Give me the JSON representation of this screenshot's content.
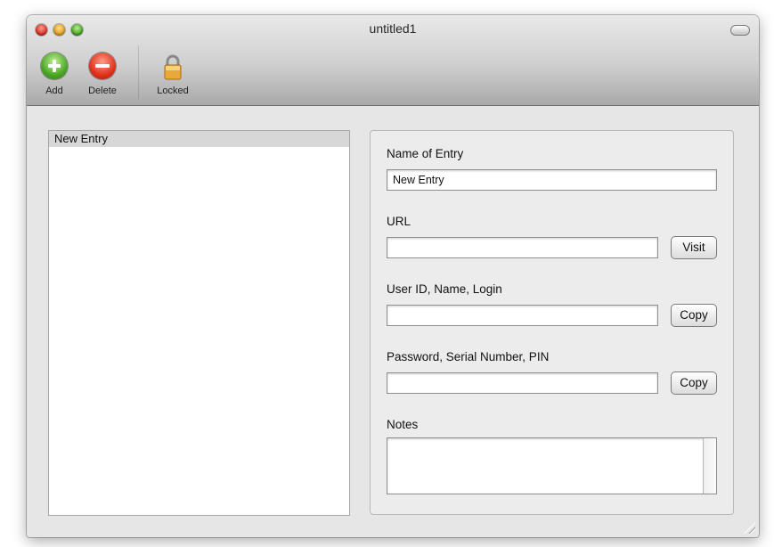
{
  "window": {
    "title": "untitled1"
  },
  "toolbar": {
    "add_label": "Add",
    "delete_label": "Delete",
    "locked_label": "Locked"
  },
  "entries": [
    {
      "name": "New Entry",
      "selected": true
    }
  ],
  "detail": {
    "name_label": "Name of Entry",
    "name_value": "New Entry",
    "url_label": "URL",
    "url_value": "",
    "visit_label": "Visit",
    "user_label": "User ID, Name, Login",
    "user_value": "",
    "copy_user_label": "Copy",
    "password_label": "Password, Serial Number, PIN",
    "password_value": "",
    "copy_password_label": "Copy",
    "notes_label": "Notes",
    "notes_value": ""
  },
  "icons": {
    "add": "plus-circle-icon",
    "delete": "minus-circle-icon",
    "locked": "padlock-icon"
  },
  "colors": {
    "add_green": "#4aa626",
    "delete_red": "#e0321c",
    "lock_gold": "#e8a93a",
    "selection_gray": "#d7d7d7"
  }
}
